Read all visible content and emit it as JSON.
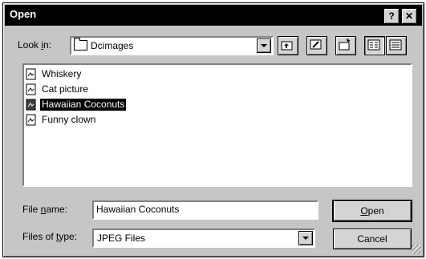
{
  "window": {
    "title": "Open",
    "help_label": "?",
    "close_label": "✕"
  },
  "lookin": {
    "label_pre": "Look ",
    "label_key": "i",
    "label_post": "n:",
    "value": "Dcimages"
  },
  "toolbar": {
    "icons": [
      "up-one-level-icon",
      "desktop-icon",
      "new-folder-icon",
      "list-view-icon",
      "details-view-icon"
    ]
  },
  "files": [
    {
      "name": "Whiskery",
      "selected": false
    },
    {
      "name": "Cat picture",
      "selected": false
    },
    {
      "name": "Hawaiian Coconuts",
      "selected": true
    },
    {
      "name": "Funny clown",
      "selected": false
    }
  ],
  "filename": {
    "label_pre": "File ",
    "label_key": "n",
    "label_post": "ame:",
    "value": "Hawaiian Coconuts"
  },
  "filetype": {
    "label_pre": "Files of ",
    "label_key": "t",
    "label_post": "ype:",
    "value": "JPEG Files"
  },
  "buttons": {
    "open_key": "O",
    "open_rest": "pen",
    "cancel": "Cancel"
  }
}
